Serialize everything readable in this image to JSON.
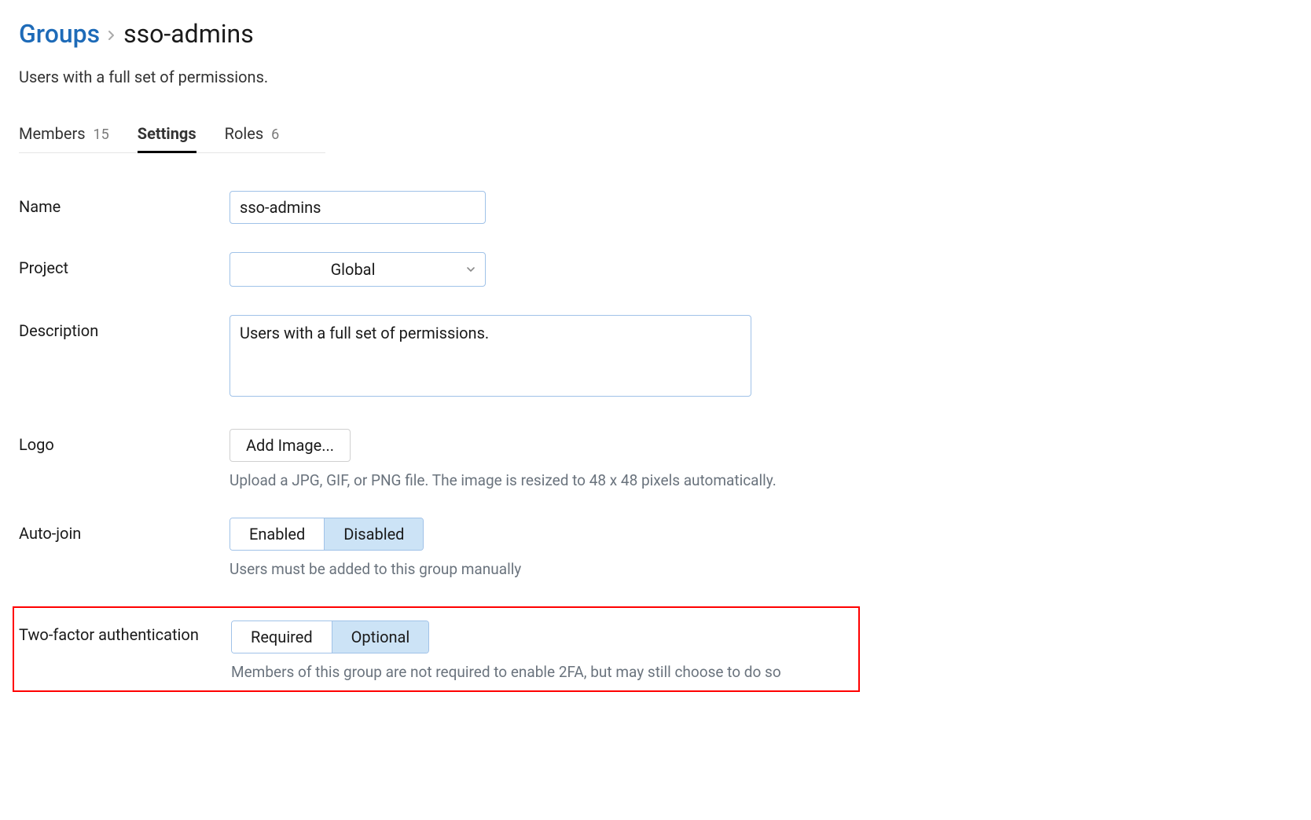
{
  "breadcrumb": {
    "root": "Groups",
    "current": "sso-admins"
  },
  "group_description": "Users with a full set of permissions.",
  "tabs": {
    "members": {
      "label": "Members",
      "count": "15"
    },
    "settings": {
      "label": "Settings"
    },
    "roles": {
      "label": "Roles",
      "count": "6"
    }
  },
  "form": {
    "name": {
      "label": "Name",
      "value": "sso-admins"
    },
    "project": {
      "label": "Project",
      "value": "Global"
    },
    "description": {
      "label": "Description",
      "value": "Users with a full set of permissions."
    },
    "logo": {
      "label": "Logo",
      "button": "Add Image...",
      "help": "Upload a JPG, GIF, or PNG file. The image is resized to 48 x 48 pixels automatically."
    },
    "autojoin": {
      "label": "Auto-join",
      "enabled": "Enabled",
      "disabled": "Disabled",
      "help": "Users must be added to this group manually"
    },
    "twofactor": {
      "label": "Two-factor authentication",
      "required": "Required",
      "optional": "Optional",
      "help": "Members of this group are not required to enable 2FA, but may still choose to do so"
    }
  }
}
